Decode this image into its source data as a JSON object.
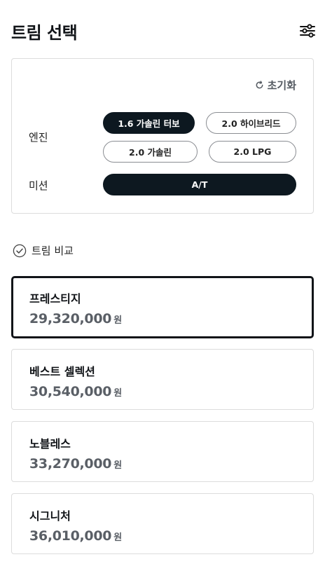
{
  "header": {
    "title": "트림 선택",
    "filter_icon": "sliders-icon"
  },
  "filter": {
    "reset_label": "초기화",
    "engine": {
      "label": "엔진",
      "options": [
        "1.6 가솔린 터보",
        "2.0 하이브리드",
        "2.0 가솔린",
        "2.0 LPG"
      ],
      "selected": "1.6 가솔린 터보"
    },
    "transmission": {
      "label": "미션",
      "options": [
        "A/T"
      ],
      "selected": "A/T"
    }
  },
  "compare_label": "트림 비교",
  "trims": [
    {
      "name": "프레스티지",
      "price": "29,320,000",
      "unit": "원",
      "selected": true
    },
    {
      "name": "베스트 셀렉션",
      "price": "30,540,000",
      "unit": "원",
      "selected": false
    },
    {
      "name": "노블레스",
      "price": "33,270,000",
      "unit": "원",
      "selected": false
    },
    {
      "name": "시그니처",
      "price": "36,010,000",
      "unit": "원",
      "selected": false
    }
  ],
  "colors": {
    "primary": "#0d1820",
    "price": "#5a5f66",
    "border": "#dcdcdc"
  }
}
